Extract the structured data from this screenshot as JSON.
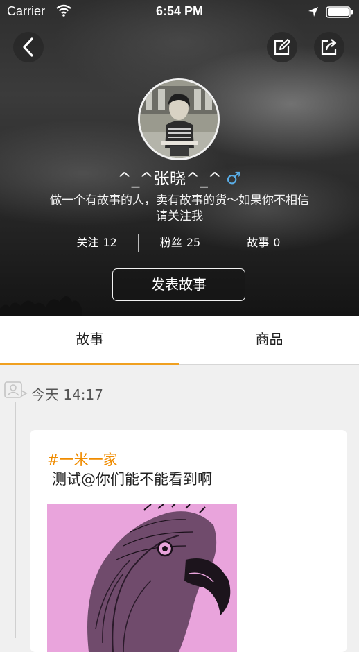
{
  "status_bar": {
    "carrier": "Carrier",
    "time": "6:54 PM"
  },
  "header": {
    "back_icon": "chevron-left-icon",
    "edit_icon": "edit-icon",
    "share_icon": "share-icon"
  },
  "profile": {
    "name": "^_^张晓^_^",
    "gender_symbol": "♂",
    "bio": "做一个有故事的人，卖有故事的货～如果你不相信请关注我",
    "stats": [
      {
        "label": "关注",
        "value": "12"
      },
      {
        "label": "粉丝",
        "value": "25"
      },
      {
        "label": "故事",
        "value": "0"
      }
    ],
    "publish_button": "发表故事"
  },
  "tabs": [
    {
      "label": "故事",
      "active": true
    },
    {
      "label": "商品",
      "active": false
    }
  ],
  "timeline": {
    "time_label": "今天 14:17",
    "post": {
      "tag": "#一米一家",
      "text": "测试@你们能不能看到啊"
    }
  },
  "colors": {
    "accent": "#f0a020",
    "tag": "#f08c00",
    "gender": "#5aaee8",
    "image_bg": "#e9a4dc"
  }
}
